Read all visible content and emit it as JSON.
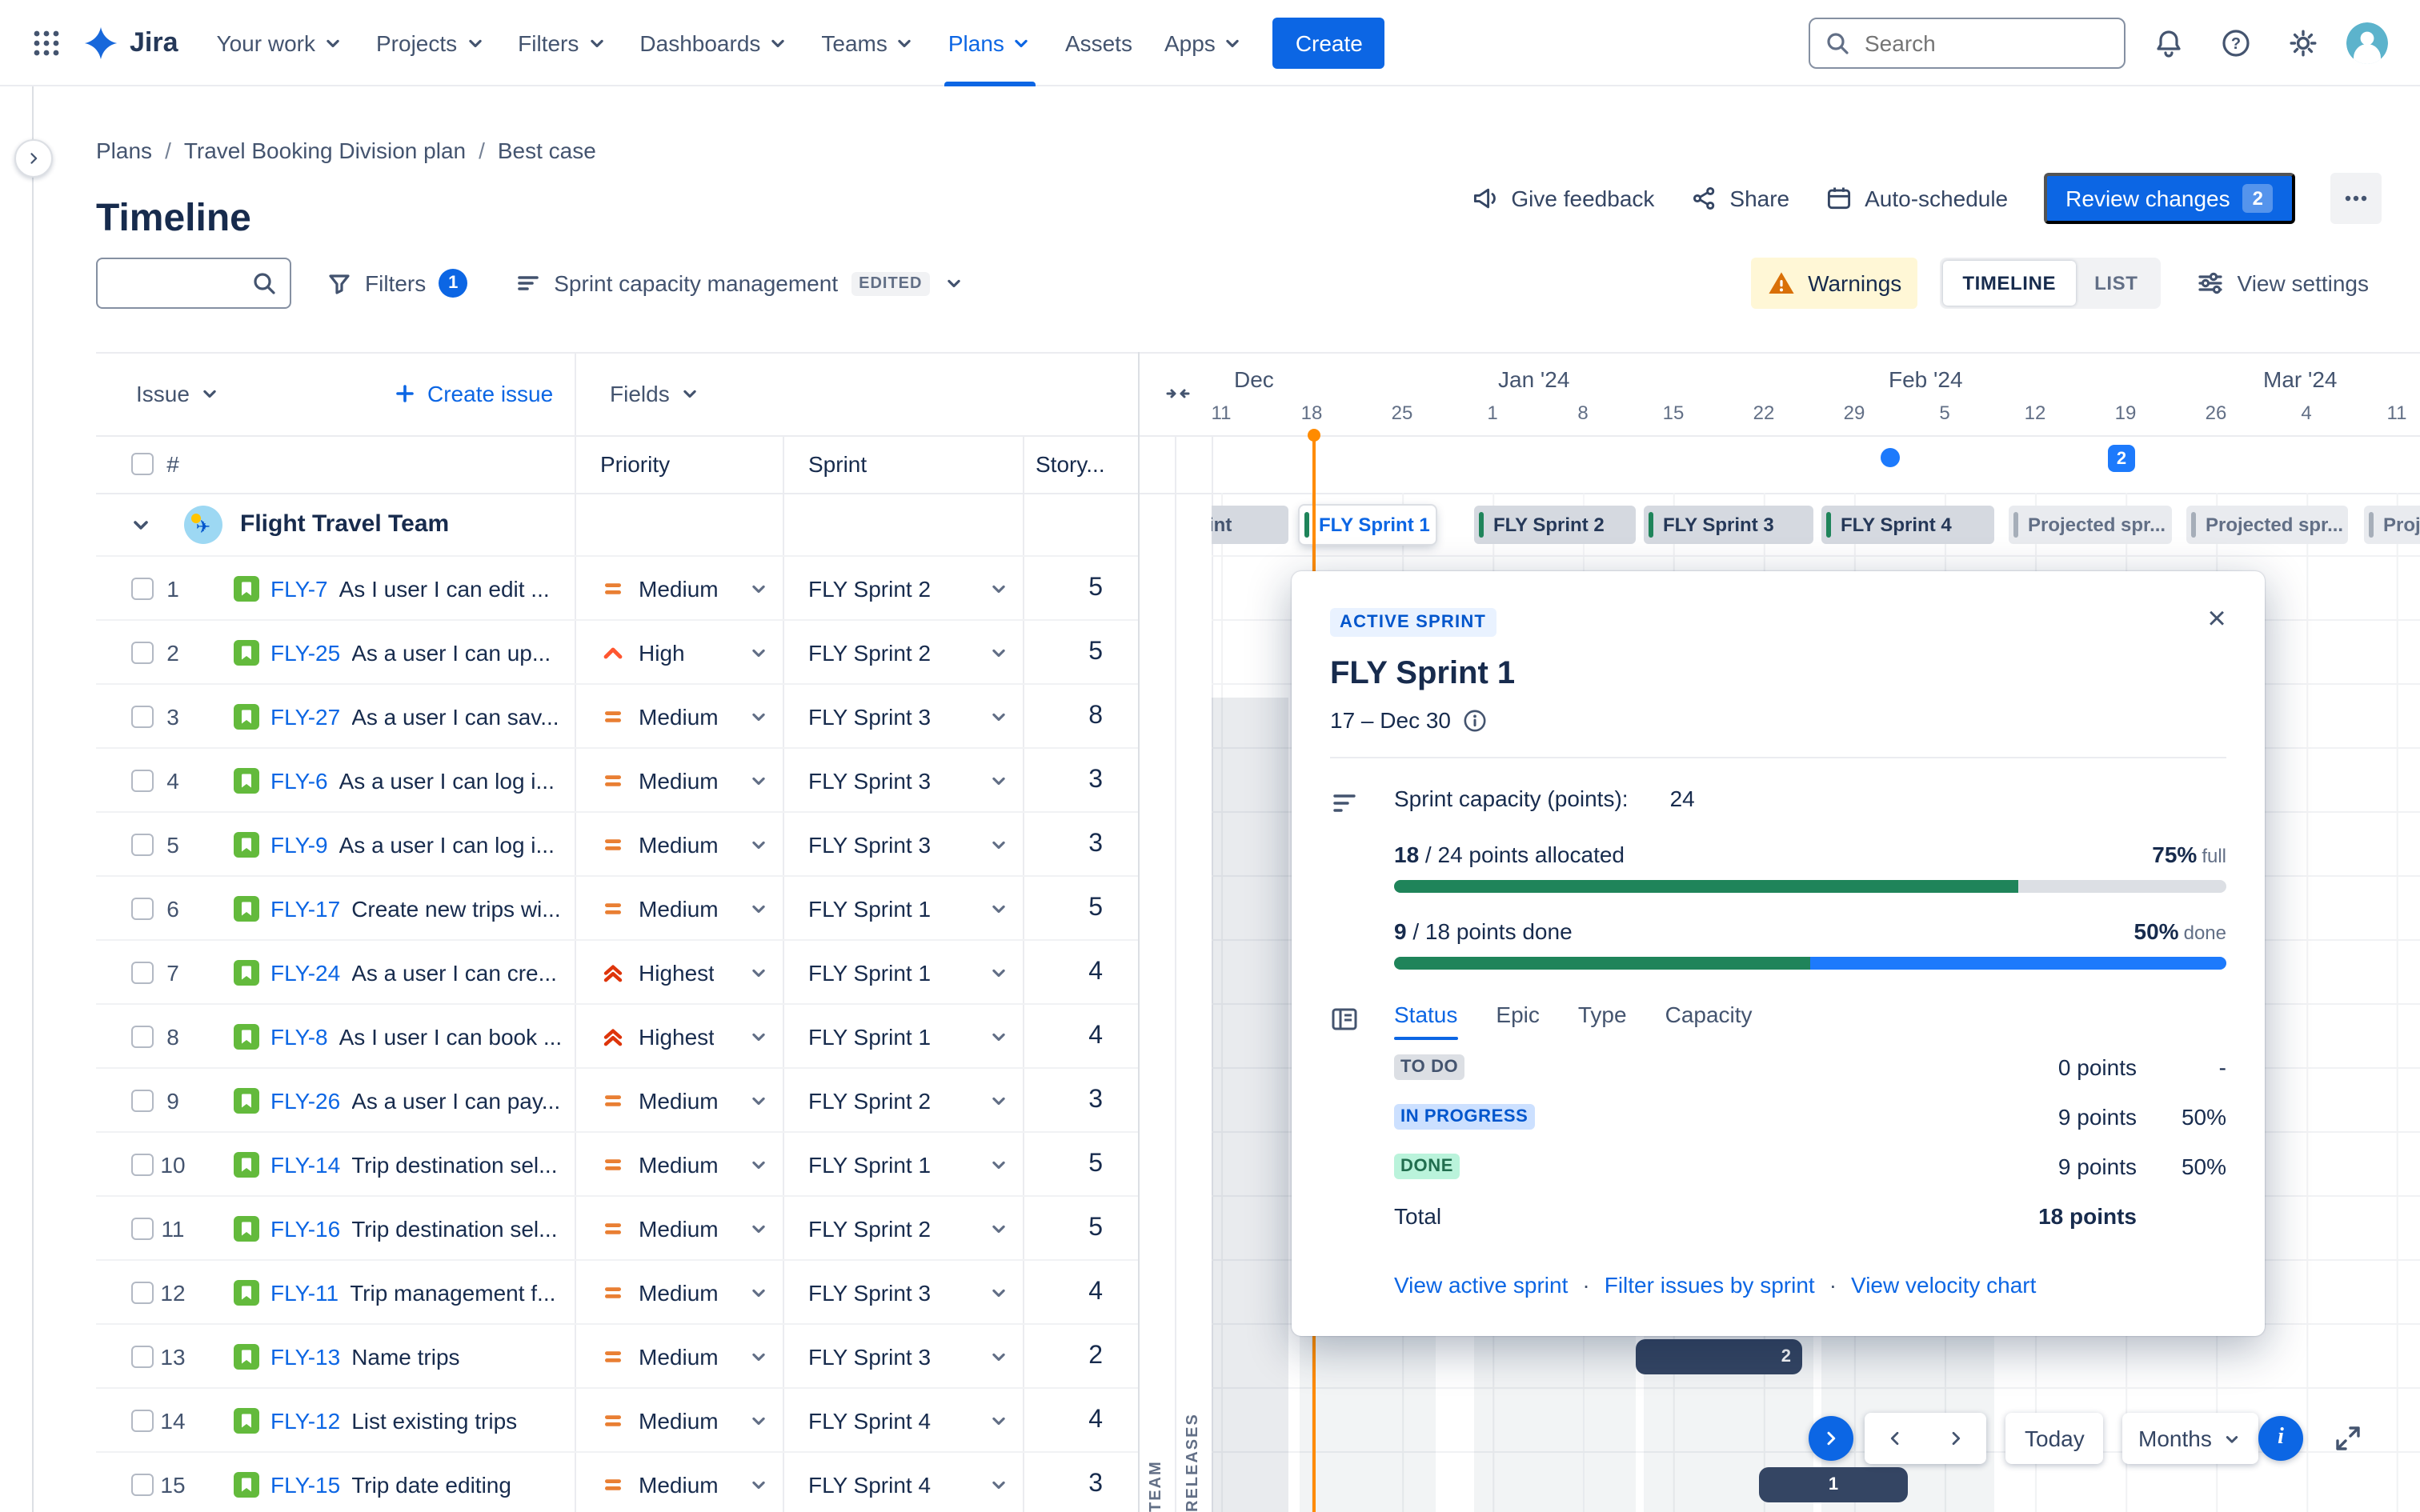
{
  "topnav": {
    "app_name": "Jira",
    "items": [
      {
        "label": "Your work",
        "chevron": true
      },
      {
        "label": "Projects",
        "chevron": true
      },
      {
        "label": "Filters",
        "chevron": true
      },
      {
        "label": "Dashboards",
        "chevron": true
      },
      {
        "label": "Teams",
        "chevron": true
      },
      {
        "label": "Plans",
        "chevron": true,
        "active": true
      },
      {
        "label": "Assets",
        "chevron": false
      },
      {
        "label": "Apps",
        "chevron": true
      }
    ],
    "create_label": "Create",
    "search_placeholder": "Search"
  },
  "breadcrumb": {
    "items": [
      "Plans",
      "Travel Booking Division plan",
      "Best case"
    ]
  },
  "page": {
    "title": "Timeline"
  },
  "header_actions": {
    "give_feedback": "Give feedback",
    "share": "Share",
    "auto_schedule": "Auto-schedule",
    "review_changes": "Review changes",
    "review_count": "2"
  },
  "toolbar": {
    "filters_label": "Filters",
    "filters_count": "1",
    "view_name": "Sprint capacity management",
    "view_state": "EDITED",
    "warnings_label": "Warnings",
    "segments": [
      "TIMELINE",
      "LIST"
    ],
    "view_settings_label": "View settings"
  },
  "table": {
    "issue_header": "Issue",
    "create_issue_label": "Create issue",
    "fields_label": "Fields",
    "columns": [
      "#",
      "Priority",
      "Sprint",
      "Story..."
    ],
    "group": {
      "name": "Flight Travel Team"
    },
    "rows": [
      {
        "num": "1",
        "key": "FLY-7",
        "summary": "As I user I can edit ...",
        "priority": "Medium",
        "sprint": "FLY Sprint 2",
        "points": "5"
      },
      {
        "num": "2",
        "key": "FLY-25",
        "summary": "As a user I can up...",
        "priority": "High",
        "sprint": "FLY Sprint 2",
        "points": "5"
      },
      {
        "num": "3",
        "key": "FLY-27",
        "summary": "As a user I can sav...",
        "priority": "Medium",
        "sprint": "FLY Sprint 3",
        "points": "8"
      },
      {
        "num": "4",
        "key": "FLY-6",
        "summary": "As a user I can log i...",
        "priority": "Medium",
        "sprint": "FLY Sprint 3",
        "points": "3"
      },
      {
        "num": "5",
        "key": "FLY-9",
        "summary": "As a user I can log i...",
        "priority": "Medium",
        "sprint": "FLY Sprint 3",
        "points": "3"
      },
      {
        "num": "6",
        "key": "FLY-17",
        "summary": "Create new trips wi...",
        "priority": "Medium",
        "sprint": "FLY Sprint 1",
        "points": "5"
      },
      {
        "num": "7",
        "key": "FLY-24",
        "summary": "As a user I can cre...",
        "priority": "Highest",
        "sprint": "FLY Sprint 1",
        "points": "4"
      },
      {
        "num": "8",
        "key": "FLY-8",
        "summary": "As I user I can book ...",
        "priority": "Highest",
        "sprint": "FLY Sprint 1",
        "points": "4"
      },
      {
        "num": "9",
        "key": "FLY-26",
        "summary": "As a user I can pay...",
        "priority": "Medium",
        "sprint": "FLY Sprint 2",
        "points": "3"
      },
      {
        "num": "10",
        "key": "FLY-14",
        "summary": "Trip destination sel...",
        "priority": "Medium",
        "sprint": "FLY Sprint 1",
        "points": "5"
      },
      {
        "num": "11",
        "key": "FLY-16",
        "summary": "Trip destination sel...",
        "priority": "Medium",
        "sprint": "FLY Sprint 2",
        "points": "5"
      },
      {
        "num": "12",
        "key": "FLY-11",
        "summary": "Trip management f...",
        "priority": "Medium",
        "sprint": "FLY Sprint 3",
        "points": "4"
      },
      {
        "num": "13",
        "key": "FLY-13",
        "summary": "Name trips",
        "priority": "Medium",
        "sprint": "FLY Sprint 3",
        "points": "2"
      },
      {
        "num": "14",
        "key": "FLY-12",
        "summary": "List existing trips",
        "priority": "Medium",
        "sprint": "FLY Sprint 4",
        "points": "4"
      },
      {
        "num": "15",
        "key": "FLY-15",
        "summary": "Trip date editing",
        "priority": "Medium",
        "sprint": "FLY Sprint 4",
        "points": "3"
      }
    ]
  },
  "timeline": {
    "months": [
      "Dec",
      "Jan '24",
      "Feb '24",
      "Mar '24"
    ],
    "ticks": [
      "11",
      "18",
      "25",
      "1",
      "8",
      "15",
      "22",
      "29",
      "5",
      "12",
      "19",
      "26",
      "4",
      "11"
    ],
    "side_labels": [
      "TEAM",
      "RELEASES"
    ],
    "sprints": [
      {
        "label": "int",
        "type": "past"
      },
      {
        "label": "FLY Sprint 1",
        "type": "active"
      },
      {
        "label": "FLY Sprint 2",
        "type": "normal"
      },
      {
        "label": "FLY Sprint 3",
        "type": "normal"
      },
      {
        "label": "FLY Sprint 4",
        "type": "normal"
      },
      {
        "label": "Projected spr...",
        "type": "projected"
      },
      {
        "label": "Projected spr...",
        "type": "projected"
      },
      {
        "label": "Proj...",
        "type": "projected"
      }
    ],
    "bars": [
      {
        "label": "2"
      },
      {
        "label": "1"
      }
    ],
    "milestone_count": "2"
  },
  "popup": {
    "badge": "ACTIVE SPRINT",
    "title": "FLY Sprint 1",
    "date_range": "17 – Dec 30",
    "capacity_label": "Sprint capacity (points):",
    "capacity_value": "24",
    "allocated_value": "18",
    "allocated_text": " / 24 points allocated",
    "allocated_pct": "75%",
    "allocated_suffix": "full",
    "allocated_fill": 75,
    "done_value": "9",
    "done_text": " / 18 points done",
    "done_pct": "50%",
    "done_suffix": "done",
    "done_fill": 50,
    "tabs": [
      {
        "label": "Status",
        "active": true
      },
      {
        "label": "Epic",
        "active": false
      },
      {
        "label": "Type",
        "active": false
      },
      {
        "label": "Capacity",
        "active": false
      }
    ],
    "status_rows": [
      {
        "label": "TO DO",
        "type": "todo",
        "points": "0 points",
        "pct": "-"
      },
      {
        "label": "IN PROGRESS",
        "type": "inprogress",
        "points": "9 points",
        "pct": "50%"
      },
      {
        "label": "DONE",
        "type": "done",
        "points": "9 points",
        "pct": "50%"
      }
    ],
    "total_label": "Total",
    "total_value": "18 points",
    "links": [
      "View active sprint",
      "Filter issues by sprint",
      "View velocity chart"
    ]
  },
  "bottom_controls": {
    "today_label": "Today",
    "zoom_label": "Months"
  },
  "colors": {
    "accent": "#0C66E4",
    "today": "#FF8B00",
    "green": "#1F845A",
    "bar_blue": "#1D7AFC"
  }
}
